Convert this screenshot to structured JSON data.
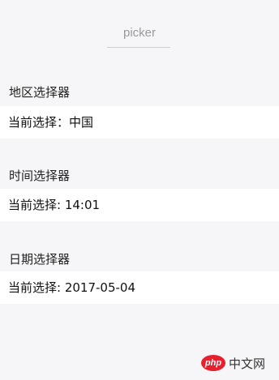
{
  "header": {
    "title": "picker"
  },
  "sections": [
    {
      "label": "地区选择器",
      "value_text": "当前选择：中国"
    },
    {
      "label": "时间选择器",
      "value_text": "当前选择: 14:01"
    },
    {
      "label": "日期选择器",
      "value_text": "当前选择: 2017-05-04"
    }
  ],
  "watermark": {
    "logo_text": "php",
    "site_text": "中文网"
  },
  "colors": {
    "background": "#f6f6f8",
    "row_background": "#ffffff",
    "title_color": "#9a9a9a",
    "watermark_logo": "#e7202e"
  }
}
